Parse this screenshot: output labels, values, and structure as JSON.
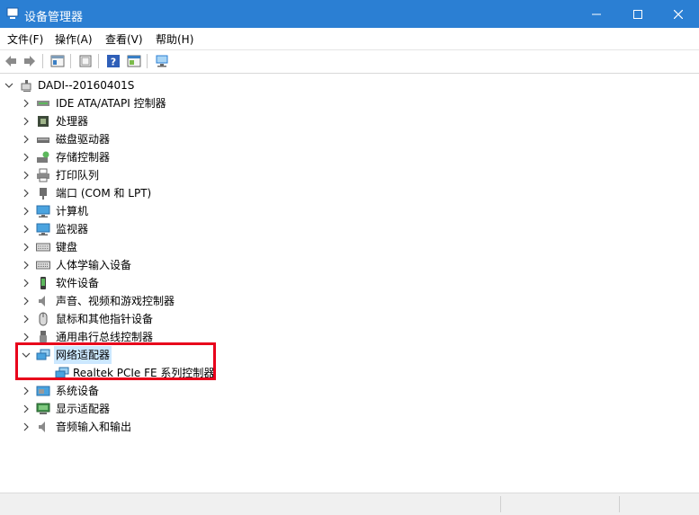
{
  "window": {
    "title": "设备管理器",
    "icon": "device-manager-icon"
  },
  "window_controls": {
    "minimize_icon": "minimize-icon",
    "maximize_icon": "maximize-icon",
    "close_icon": "close-icon"
  },
  "menu": {
    "file": "文件(F)",
    "action": "操作(A)",
    "view": "查看(V)",
    "help": "帮助(H)"
  },
  "toolbar": {
    "items": [
      "back-arrow-icon",
      "forward-arrow-icon",
      "properties-icon",
      "update-driver-icon",
      "help-icon",
      "console-icon",
      "scan-hardware-icon"
    ]
  },
  "tree": {
    "root": "DADI--20160401S",
    "categories": [
      {
        "label": "IDE ATA/ATAPI 控制器",
        "icon": "ide-controller-icon",
        "expanded": false
      },
      {
        "label": "处理器",
        "icon": "processor-icon",
        "expanded": false
      },
      {
        "label": "磁盘驱动器",
        "icon": "disk-drive-icon",
        "expanded": false
      },
      {
        "label": "存储控制器",
        "icon": "storage-controller-icon",
        "expanded": false
      },
      {
        "label": "打印队列",
        "icon": "printer-icon",
        "expanded": false
      },
      {
        "label": "端口 (COM 和 LPT)",
        "icon": "port-icon",
        "expanded": false
      },
      {
        "label": "计算机",
        "icon": "computer-icon",
        "expanded": false
      },
      {
        "label": "监视器",
        "icon": "monitor-icon",
        "expanded": false
      },
      {
        "label": "键盘",
        "icon": "keyboard-icon",
        "expanded": false
      },
      {
        "label": "人体学输入设备",
        "icon": "hid-icon",
        "expanded": false
      },
      {
        "label": "软件设备",
        "icon": "software-device-icon",
        "expanded": false
      },
      {
        "label": "声音、视频和游戏控制器",
        "icon": "sound-icon",
        "expanded": false
      },
      {
        "label": "鼠标和其他指针设备",
        "icon": "mouse-icon",
        "expanded": false
      },
      {
        "label": "通用串行总线控制器",
        "icon": "usb-icon",
        "expanded": false
      },
      {
        "label": "网络适配器",
        "icon": "network-adapter-icon",
        "expanded": true,
        "selected": true
      },
      {
        "label": "系统设备",
        "icon": "system-device-icon",
        "expanded": false
      },
      {
        "label": "显示适配器",
        "icon": "display-adapter-icon",
        "expanded": false
      },
      {
        "label": "音频输入和输出",
        "icon": "audio-io-icon",
        "expanded": false
      }
    ],
    "network_child": "Realtek PCIe FE 系列控制器"
  },
  "colors": {
    "titlebar": "#2b7fd3",
    "selection": "#cce8ff",
    "highlight_box": "#e8001b"
  }
}
